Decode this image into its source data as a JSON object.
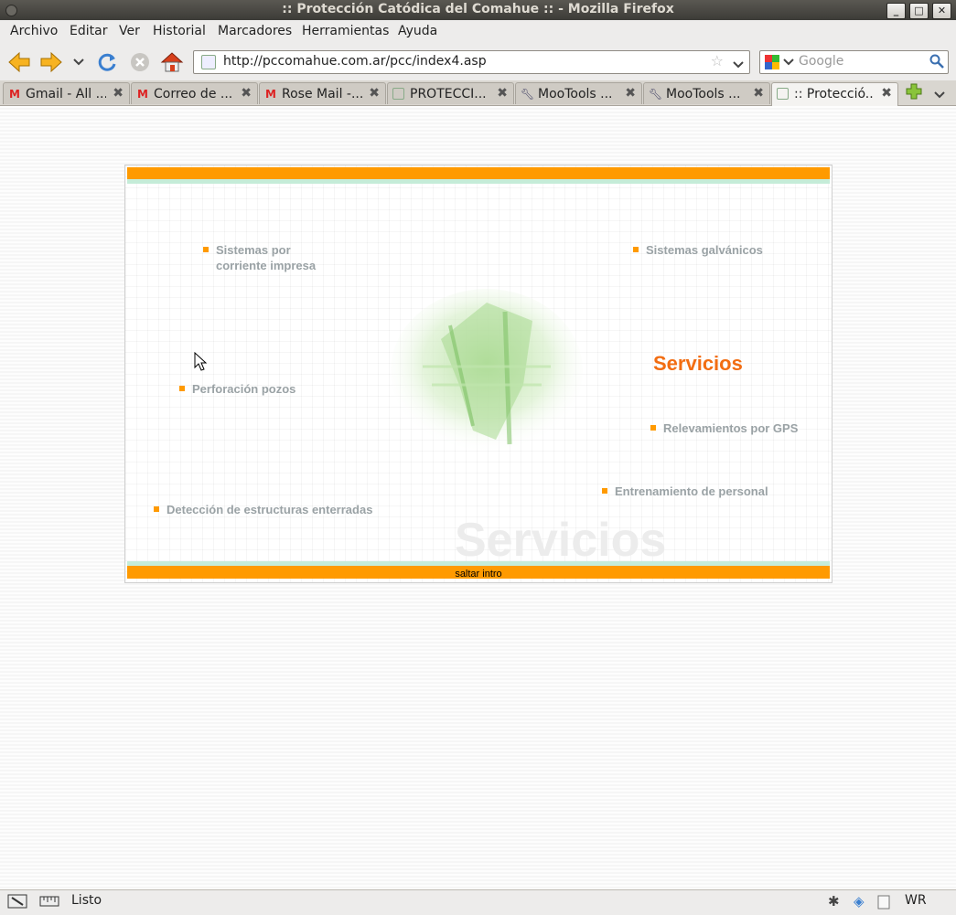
{
  "window": {
    "title": ":: Protección Catódica del Comahue :: - Mozilla Firefox"
  },
  "menu": [
    "Archivo",
    "Editar",
    "Ver",
    "Historial",
    "Marcadores",
    "Herramientas",
    "Ayuda"
  ],
  "address": {
    "url": "http://pccomahue.com.ar/pcc/index4.asp"
  },
  "search": {
    "placeholder": "Google"
  },
  "tabs": [
    {
      "label": "Gmail - All ...",
      "icon": "gmail-icon"
    },
    {
      "label": "Correo de ...",
      "icon": "gmail-icon"
    },
    {
      "label": "Rose Mail -...",
      "icon": "gmail-icon"
    },
    {
      "label": "PROTECCI...",
      "icon": "page-icon"
    },
    {
      "label": "MooTools ...",
      "icon": "wrench-icon"
    },
    {
      "label": "MooTools ...",
      "icon": "wrench-icon"
    },
    {
      "label": ":: Protecció...",
      "icon": "page-icon"
    }
  ],
  "page": {
    "services": {
      "corriente": "Sistemas por\ncorriente impresa",
      "galvanicos": "Sistemas galvánicos",
      "pozos": "Perforación pozos",
      "gps": "Relevamientos por GPS",
      "entrenamiento": "Entrenamiento de personal",
      "deteccion": "Detección de estructuras enterradas"
    },
    "heading": "Servicios",
    "watermark": "Servicios",
    "skip_intro": "saltar intro"
  },
  "status": {
    "text": "Listo",
    "indicator": "WR"
  },
  "colors": {
    "orange": "#ff9a00",
    "heading": "#f26d12",
    "mint": "#c5ecd8",
    "service_text": "#9aa2a5"
  }
}
